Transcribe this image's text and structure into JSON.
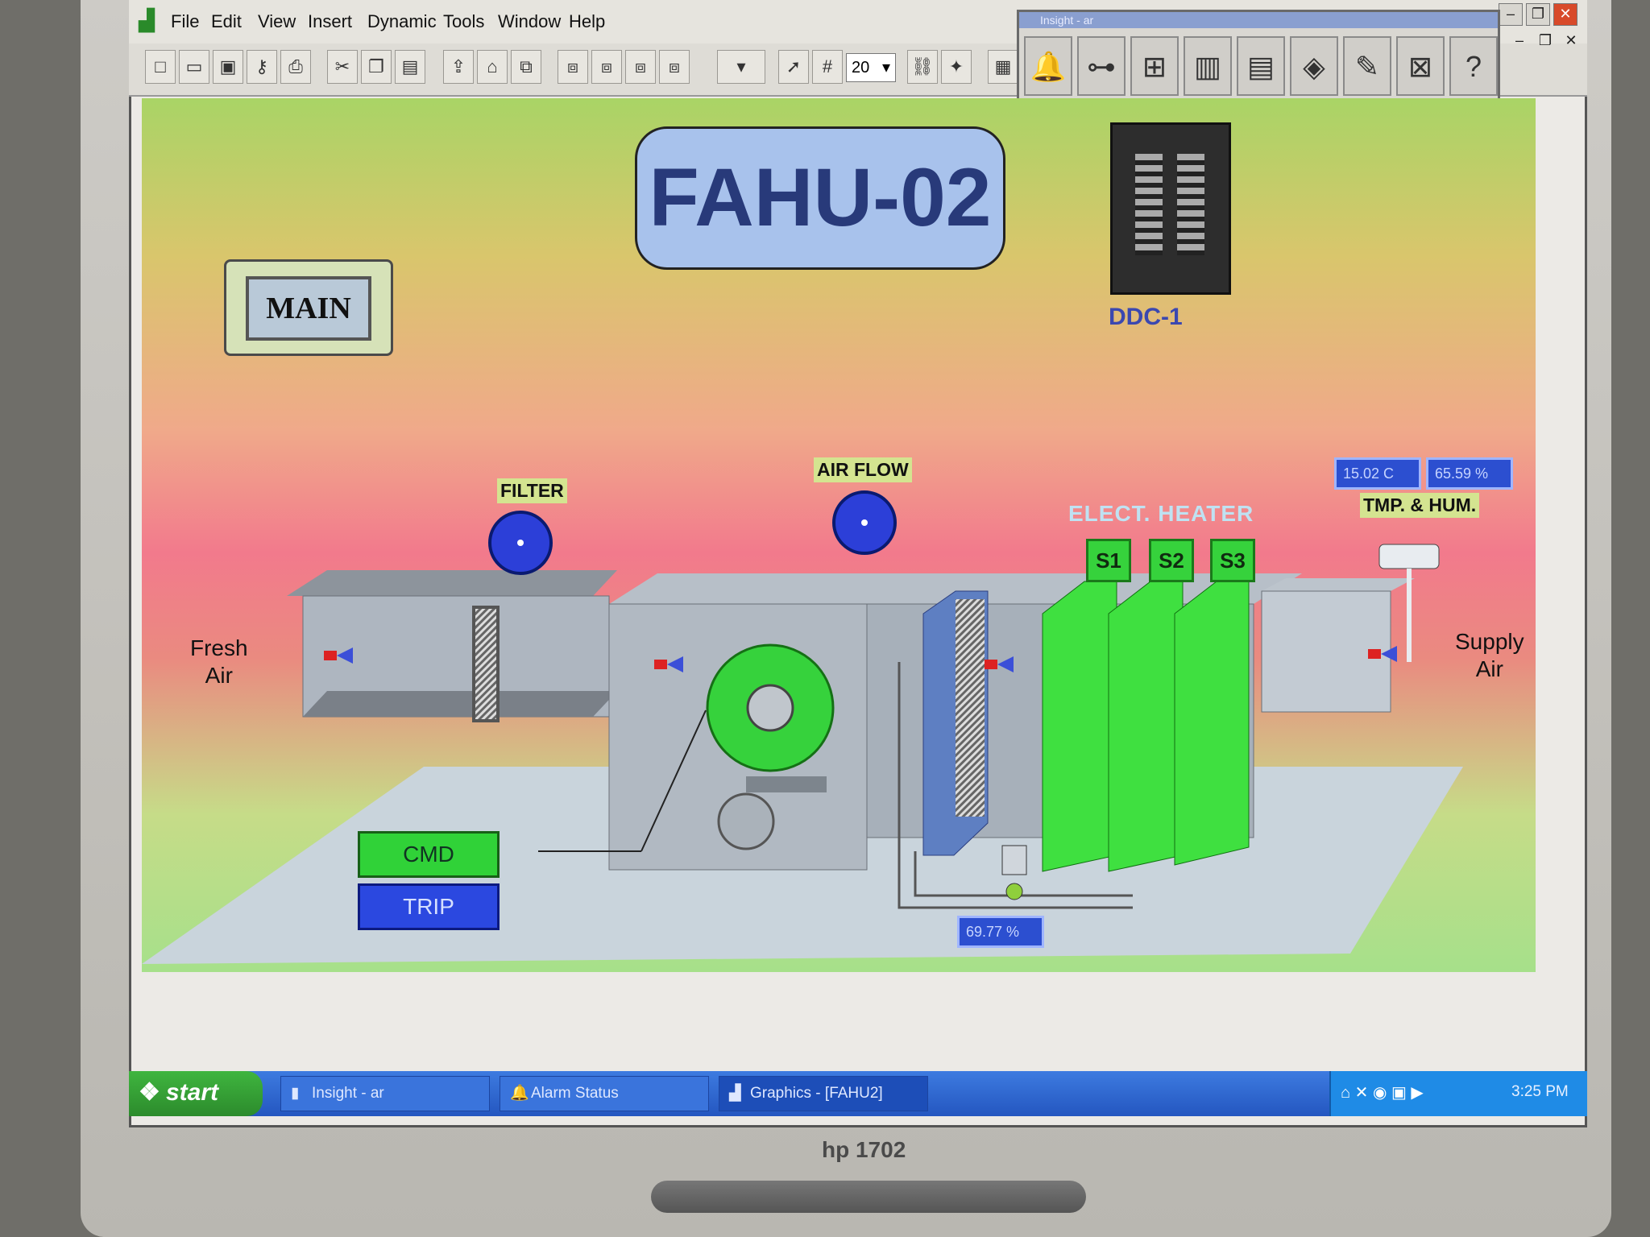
{
  "menubar": {
    "items": [
      "File",
      "Edit",
      "View",
      "Insert",
      "Dynamic",
      "Tools",
      "Window",
      "Help"
    ]
  },
  "toolbar": {
    "zoom_value": "20"
  },
  "insight_toolbar": {
    "title": "Insight - ar"
  },
  "graphic": {
    "title": "FAHU-02",
    "main_button": "MAIN",
    "controller_label": "DDC-1",
    "filter_label": "FILTER",
    "airflow_label": "AIR FLOW",
    "heater_label": "ELECT. HEATER",
    "heater_stages": [
      "S1",
      "S2",
      "S3"
    ],
    "fresh_air_label": [
      "Fresh",
      "Air"
    ],
    "supply_air_label": [
      "Supply",
      "Air"
    ],
    "temp_value": "15.02 C",
    "humidity_value": "65.59 %",
    "temp_hum_label": "TMP. & HUM.",
    "valve_value": "69.77 %",
    "cmd_label": "CMD",
    "trip_label": "TRIP"
  },
  "colors": {
    "canvas_top": "#a9d466",
    "canvas_mid": "#f27a8c",
    "fan_green": "#36d23c",
    "value_blue": "#2c4fd0"
  },
  "taskbar": {
    "start_label": "start",
    "tasks": [
      "Insight - ar",
      "Alarm Status",
      "Graphics - [FAHU2]"
    ],
    "clock": "3:25 PM"
  },
  "monitor": {
    "brand": "hp 1702"
  }
}
